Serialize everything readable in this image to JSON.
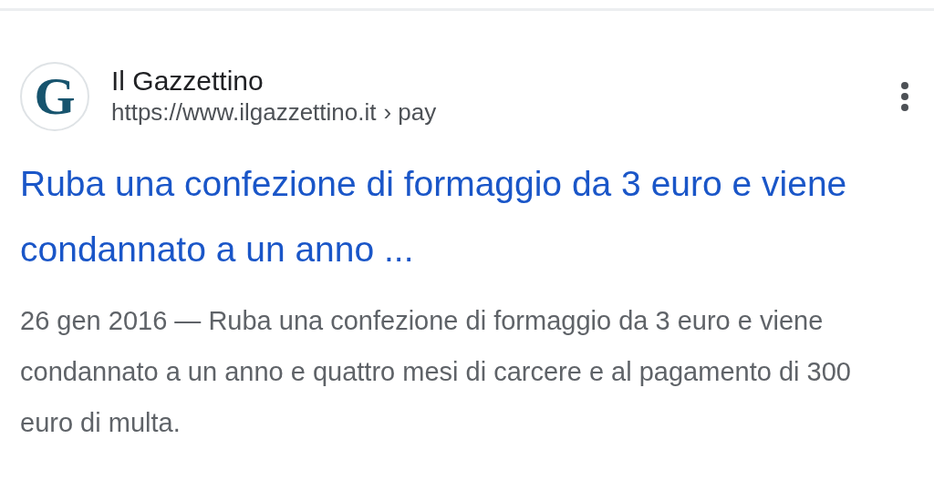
{
  "result": {
    "logo_letter": "G",
    "site_name": "Il Gazzettino",
    "url": "https://www.ilgazzettino.it",
    "breadcrumb": "› pay",
    "title": "Ruba una confezione di formaggio da 3 euro e viene condannato a un anno ...",
    "date": "26 gen 2016",
    "snippet": "— Ruba una confezione di formaggio da 3 euro e viene condannato a un anno e quattro mesi di carcere e al pagamento di 300 euro di multa."
  }
}
